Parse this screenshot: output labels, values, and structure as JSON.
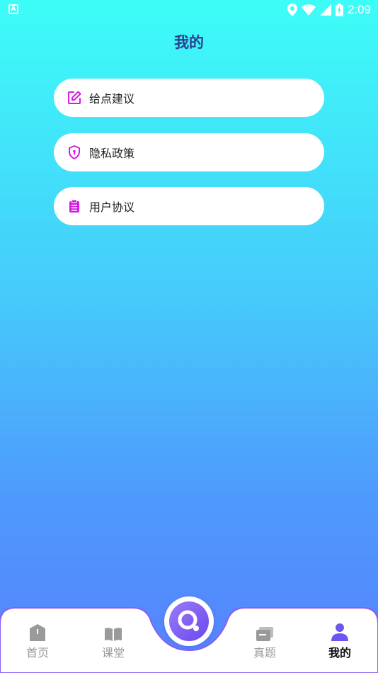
{
  "status_bar": {
    "time": "2:09"
  },
  "header": {
    "title": "我的"
  },
  "menu": {
    "items": [
      {
        "label": "给点建议",
        "icon": "edit-icon"
      },
      {
        "label": "隐私政策",
        "icon": "shield-icon"
      },
      {
        "label": "用户协议",
        "icon": "clipboard-icon"
      }
    ]
  },
  "bottom_nav": {
    "tabs": [
      {
        "label": "首页",
        "icon": "home-icon",
        "active": false
      },
      {
        "label": "课堂",
        "icon": "book-icon",
        "active": false
      },
      {
        "label": "真题",
        "icon": "cards-icon",
        "active": false
      },
      {
        "label": "我的",
        "icon": "user-icon",
        "active": true
      }
    ],
    "center_icon": "search-icon"
  },
  "colors": {
    "accent": "#d21ee0",
    "nav_active": "#6b56f0",
    "nav_inactive": "#9a9a9a",
    "title": "#2a3f8e",
    "gradient_top": "#3dfdf8",
    "gradient_bottom": "#5682fd"
  }
}
